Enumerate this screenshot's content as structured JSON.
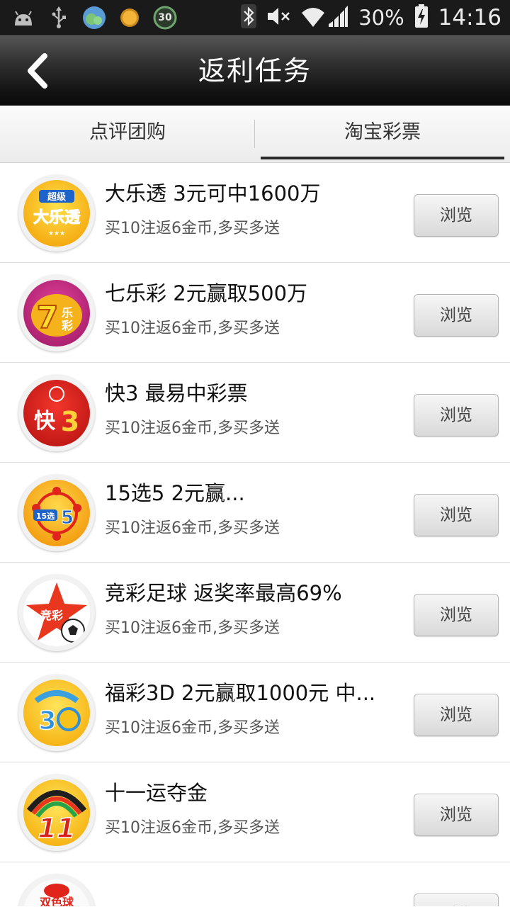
{
  "status_bar": {
    "left_icons": [
      "android-icon",
      "usb-icon",
      "chat-app-icon",
      "coin-app-icon",
      "timer-30-icon"
    ],
    "timer_badge": "30",
    "battery_percent": "30%",
    "clock": "14:16"
  },
  "header": {
    "title": "返利任务"
  },
  "tabs": [
    {
      "label": "点评团购",
      "active": false
    },
    {
      "label": "淘宝彩票",
      "active": true
    }
  ],
  "list": {
    "browse_label": "浏览",
    "items": [
      {
        "title": "大乐透 3元可中1600万",
        "subtitle": "买10注返6金币,多买多送",
        "logo": "super-lotto-logo",
        "logo_text": "超级大乐透"
      },
      {
        "title": "七乐彩 2元赢取500万",
        "subtitle": "买10注返6金币,多买多送",
        "logo": "qilecai-logo",
        "logo_text": "7乐彩"
      },
      {
        "title": "快3 最易中彩票",
        "subtitle": "买10注返6金币,多买多送",
        "logo": "kuai3-logo",
        "logo_text": "快3"
      },
      {
        "title": "15选5 2元赢...",
        "subtitle": "买10注返6金币,多买多送",
        "logo": "15xuan5-logo",
        "logo_text": "15选5"
      },
      {
        "title": "竞彩足球 返奖率最高69%",
        "subtitle": "买10注返6金币,多买多送",
        "logo": "jingcai-football-logo",
        "logo_text": "竞彩"
      },
      {
        "title": "福彩3D 2元赢取1000元 中...",
        "subtitle": "买10注返6金币,多买多送",
        "logo": "fucai-3d-logo",
        "logo_text": "3D"
      },
      {
        "title": "十一运夺金",
        "subtitle": "买10注返6金币,多买多送",
        "logo": "11yun-logo",
        "logo_text": "11"
      },
      {
        "title": "",
        "subtitle": "",
        "logo": "shuangseqiu-logo",
        "logo_text": "双色球"
      }
    ]
  },
  "colors": {
    "title_bar": "#1a1a1a",
    "tab_indicator": "#2a2a2a",
    "button_bg": "#e6e6e6"
  }
}
